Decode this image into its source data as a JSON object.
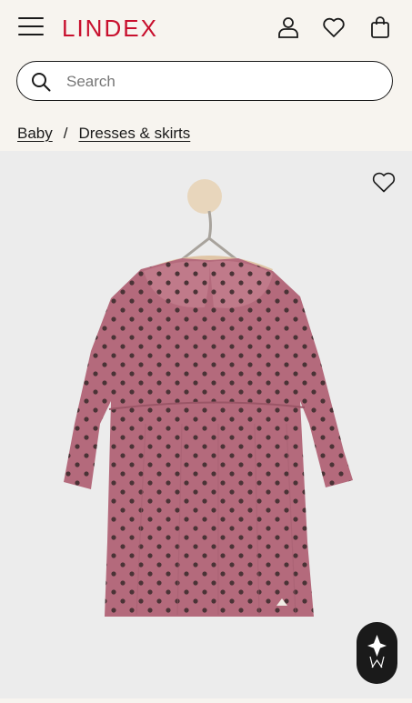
{
  "header": {
    "brand": "LINDEX",
    "icons": [
      "menu-icon",
      "account-icon",
      "heart-icon",
      "bag-icon"
    ]
  },
  "search": {
    "placeholder": "Search",
    "value": ""
  },
  "breadcrumb": {
    "items": [
      "Baby",
      "Dresses & skirts"
    ],
    "separator": "/"
  },
  "product": {
    "image": "pink polka-dot velour baby dress with peter-pan collar on wooden hanger",
    "dress_color": "#b46a7c",
    "dot_color": "#4a3336"
  },
  "colors": {
    "brand": "#c8102e",
    "background": "#f7f4ef",
    "image_bg": "#ececec"
  }
}
